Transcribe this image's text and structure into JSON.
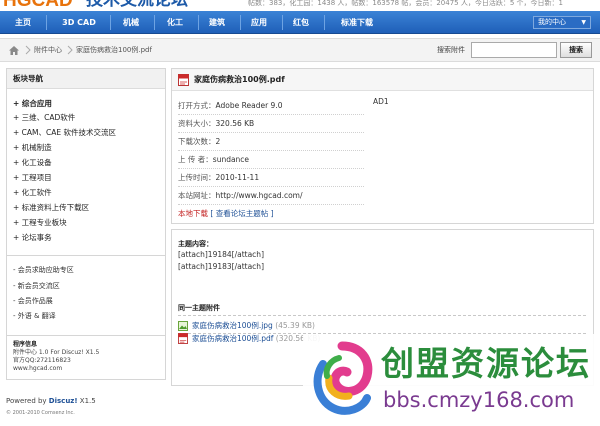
{
  "header": {
    "logo_text": "HGCAD",
    "logo_sub": "技术交流论坛",
    "stats_text": "帖数：383，化工园：1438 人，帖数：163578 帖，会员：20475 人，今日活跃：5 个，今日新：1"
  },
  "nav": {
    "items": [
      "主页",
      "3D CAD",
      "机械",
      "化工",
      "建筑",
      "应用",
      "红包",
      "标准下载"
    ],
    "my_center": "我的中心"
  },
  "breadcrumb": {
    "items": [
      "附件中心",
      "家庭伤病救治100例.pdf"
    ],
    "search_label": "搜索附件",
    "search_value": "",
    "search_button": "搜索"
  },
  "sidebar": {
    "header": "板块导航",
    "sections": [
      {
        "label": "+ 综合应用",
        "bold": true
      },
      {
        "label": "+ 三维、CAD软件",
        "bold": false
      },
      {
        "label": "+ CAM、CAE 软件技术交流区",
        "bold": false
      },
      {
        "label": "+ 机械制造",
        "bold": false
      },
      {
        "label": "+ 化工设备",
        "bold": false
      },
      {
        "label": "+ 工程项目",
        "bold": false
      },
      {
        "label": "+ 化工软件",
        "bold": false
      },
      {
        "label": "+ 标准资料上传下载区",
        "bold": false
      },
      {
        "label": "+ 工程专业板块",
        "bold": false
      },
      {
        "label": "+ 论坛事务",
        "bold": false
      }
    ],
    "links": [
      "- 会员求助应助专区",
      "- 新会员交流区",
      "- 会员作品展",
      "- 外语 & 翻译"
    ],
    "info_title": "程序信息",
    "info_lines": [
      "附件中心 1.0 For Discuz! X1.5",
      "官方QQ:272116823",
      "www.hgcad.com"
    ]
  },
  "attachment": {
    "title": "家庭伤病救治100例.pdf",
    "rows": [
      {
        "label": "打开方式：",
        "value": "Adobe Reader 9.0"
      },
      {
        "label": "资料大小：",
        "value": "320.56 KB"
      },
      {
        "label": "下载次数：",
        "value": "2"
      },
      {
        "label": "上 传 者：",
        "value": "sundance"
      },
      {
        "label": "上传时间：",
        "value": "2010-11-11"
      },
      {
        "label": "本站网址：",
        "value": "http://www.hgcad.com/"
      }
    ],
    "download_label": "本地下载",
    "download_link": "[ 查看论坛主题帖 ]",
    "ad_text": "AD1"
  },
  "content": {
    "title": "主题内容：",
    "lines": [
      "[attach]19184[/attach]",
      "[attach]19183[/attach]"
    ],
    "related_title": "同一主题附件",
    "attachments": [
      {
        "name": "家庭伤病救治100例.jpg",
        "size": "(45.39 KB)",
        "icon": "image-file-icon"
      },
      {
        "name": "家庭伤病救治100例.pdf",
        "size": "(320.56 KB)",
        "icon": "pdf-file-icon"
      }
    ]
  },
  "footer": {
    "powered_prefix": "Powered by ",
    "powered_brand": "Discuz!",
    "powered_version": " X1.5",
    "copyright": "© 2001-2010 Comsenz Inc."
  },
  "watermark": {
    "title": "创盟资源论坛",
    "url": "bbs.cmzy168.com"
  },
  "colors": {
    "nav_blue": "#2a6cc4",
    "logo_orange": "#e8730c",
    "link_blue": "#1d4f95",
    "download_red": "#c32020",
    "watermark_green": "#2b8d3c",
    "watermark_purple": "#7a3a90"
  }
}
